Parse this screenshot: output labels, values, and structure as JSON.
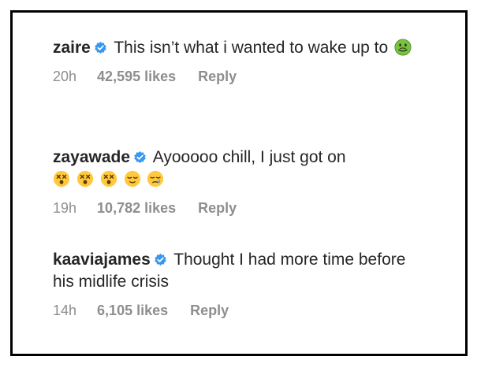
{
  "comments": [
    {
      "username": "zaire",
      "text": "This isn’t what i wanted to wake up to",
      "emojis": [
        "nauseated-face-emoji"
      ],
      "time": "20h",
      "likes": "42,595 likes",
      "reply": "Reply"
    },
    {
      "username": "zayawade",
      "text": "Ayooooo chill, I just got on",
      "emojis": [
        "dizzy-face-emoji",
        "dizzy-face-emoji",
        "dizzy-face-emoji",
        "relieved-face-emoji",
        "sleepy-face-emoji"
      ],
      "time": "19h",
      "likes": "10,782 likes",
      "reply": "Reply"
    },
    {
      "username": "kaaviajames",
      "text": "Thought I had more time before his midlife crisis",
      "emojis": [],
      "time": "14h",
      "likes": "6,105 likes",
      "reply": "Reply"
    }
  ],
  "colors": {
    "text": "#262626",
    "meta": "#8e8e8e",
    "verified": "#3897f0",
    "border": "#000000"
  }
}
